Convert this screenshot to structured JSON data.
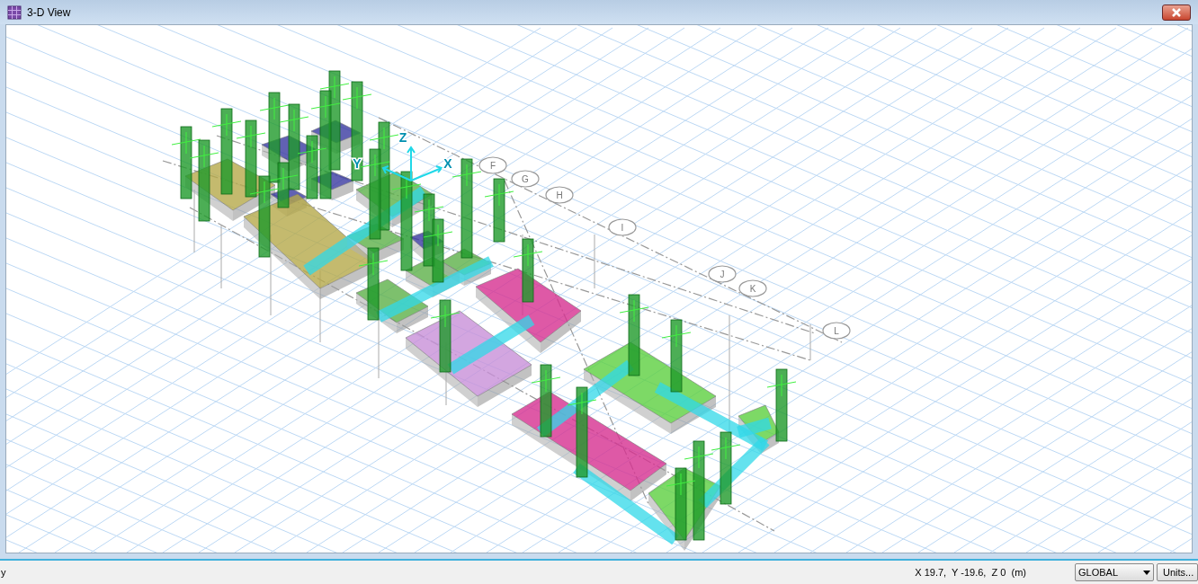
{
  "window": {
    "title": "3-D View"
  },
  "view": {
    "grid_bubbles": [
      {
        "label": "F"
      },
      {
        "label": "G"
      },
      {
        "label": "H"
      },
      {
        "label": "I"
      },
      {
        "label": "J"
      },
      {
        "label": "K"
      },
      {
        "label": "L"
      }
    ],
    "axes": [
      {
        "label": "X"
      },
      {
        "label": "Y"
      },
      {
        "label": "Z"
      }
    ]
  },
  "status_bar": {
    "message": "y",
    "coordinates": "X 19.7,  Y -19.6,  Z 0  (m)",
    "coordinate_system": "GLOBAL",
    "units_button": "Units..."
  }
}
